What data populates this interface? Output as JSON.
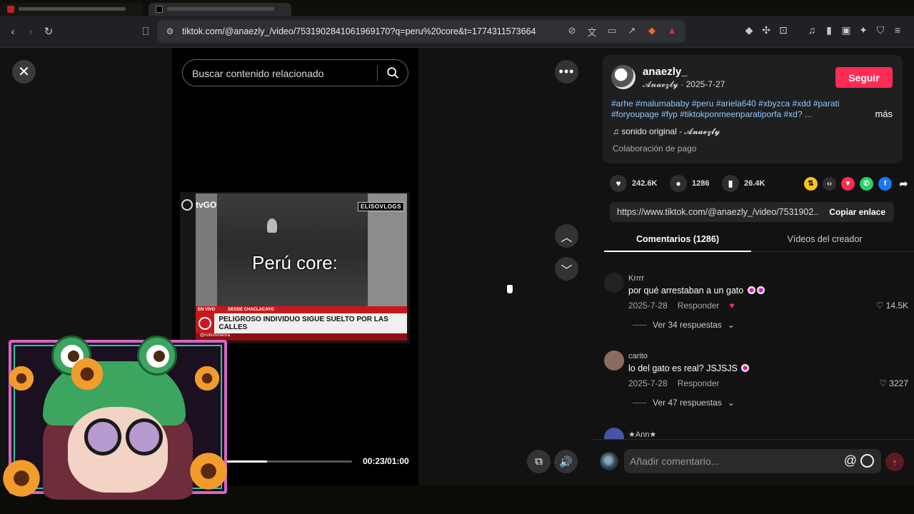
{
  "browser": {
    "url": "tiktok.com/@anaezly_/video/7531902841061969170?q=peru%20core&t=1774311573664"
  },
  "player": {
    "search_placeholder": "Buscar contenido relacionado",
    "overlay_text": "Perú core:",
    "channel_logo": "tvGO",
    "watermark": "ELISOVLOGS",
    "news_tag_1": "EN VIVO",
    "news_tag_2": "DESDE CHACLACAYO",
    "news_headline": "PELIGROSO INDIVIDUO SIGUE SUELTO POR LAS CALLES",
    "news_source": "@noticiAmerica",
    "time": "00:23/01:00",
    "progress": 0.38
  },
  "post": {
    "username": "anaezly_",
    "nickname": "𝓐𝓷𝓪𝓮𝔃𝓵𝔂 · 2025-7-27",
    "follow_label": "Seguir",
    "hashtags": "#arhe #malumababy #peru #ariela640 #xbyzca #xdd #parati #foryoupage #fyp #tiktokponmeenparatiporfa #xd? ...",
    "more_label": "más",
    "sound": "sonido original - 𝓐𝓷𝓪𝓮𝔃𝓵𝔂",
    "collab": "Colaboración de pago",
    "likes": "242.6K",
    "comments": "1286",
    "saves": "26.4K",
    "link": "https://www.tiktok.com/@anaezly_/video/7531902...",
    "copy_label": "Copiar enlace"
  },
  "tabs": {
    "comments": "Comentarios (1286)",
    "creator_videos": "Vídeos del creador"
  },
  "comments": [
    {
      "user": "Krrrr",
      "text": "por qué arrestaban a un gato",
      "date": "2025-7-28",
      "reply": "Responder",
      "likes": "14.5K",
      "replies": "Ver 34 respuestas"
    },
    {
      "user": "carito",
      "text": "lo del gato es real? JSJSJS",
      "date": "2025-7-28",
      "reply": "Responder",
      "likes": "3227",
      "replies": "Ver 47 respuestas"
    },
    {
      "user": "★Ann★"
    }
  ],
  "comment_input": {
    "placeholder": "Añadir comentario..."
  },
  "colors": {
    "accent": "#fe2c55",
    "hashtag": "#8fc8ff"
  }
}
